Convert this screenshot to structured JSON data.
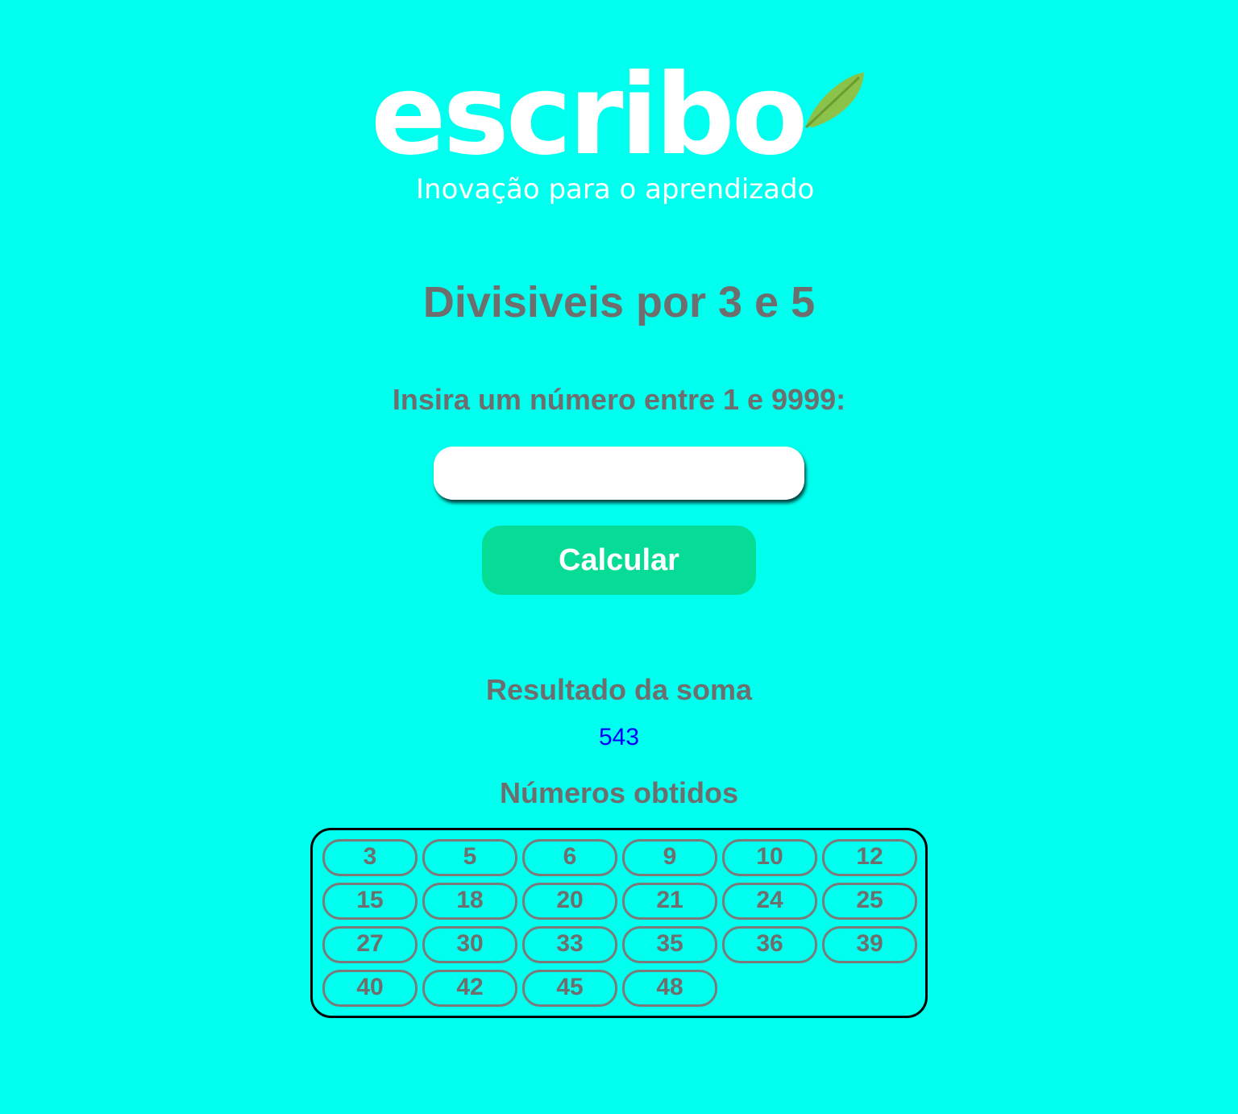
{
  "brand": {
    "wordmark": "escribo",
    "tagline": "Inovação para o aprendizado"
  },
  "page": {
    "title": "Divisiveis por 3 e 5",
    "prompt": "Insira um número entre 1 e 9999:"
  },
  "input": {
    "value": "",
    "placeholder": ""
  },
  "actions": {
    "calculate_label": "Calcular"
  },
  "results": {
    "sum_label": "Resultado da soma",
    "sum_value": "543",
    "numbers_label": "Números obtidos",
    "numbers": [
      "3",
      "5",
      "6",
      "9",
      "10",
      "12",
      "15",
      "18",
      "20",
      "21",
      "24",
      "25",
      "27",
      "30",
      "33",
      "35",
      "36",
      "39",
      "40",
      "42",
      "45",
      "48"
    ]
  },
  "colors": {
    "background": "#00FFEE",
    "button": "#06DC95",
    "text_muted": "#6E6E6E",
    "sum_value": "#0000FF",
    "leaf": "#8BC34A"
  },
  "icons": {
    "logo_leaf": "leaf-icon"
  }
}
